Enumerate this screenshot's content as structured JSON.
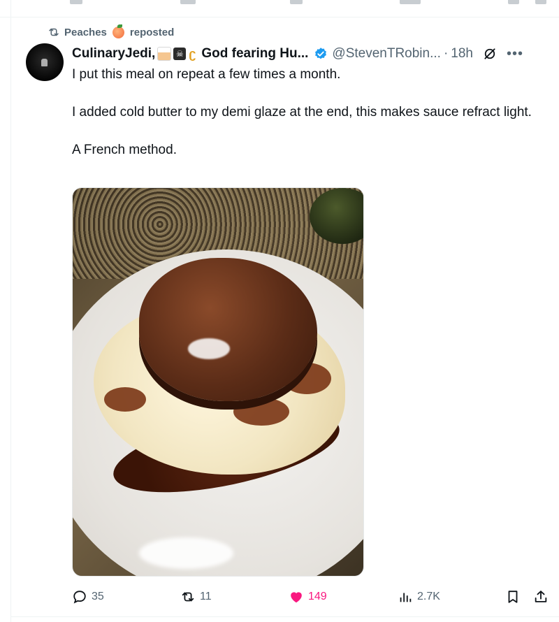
{
  "repost": {
    "user": "Peaches",
    "label": "reposted"
  },
  "author": {
    "display_name": "CulinaryJedi,",
    "name_suffix": "God fearing Hu...",
    "handle": "@StevenTRobin...",
    "separator": "·",
    "time": "18h"
  },
  "tweet": {
    "paragraphs": [
      "I put this meal on repeat a few times a month.",
      "I added cold butter to my demi glaze at the end, this makes sauce refract light.",
      "A French method."
    ]
  },
  "actions": {
    "replies": "35",
    "reposts": "11",
    "likes": "149",
    "views": "2.7K"
  },
  "colors": {
    "like": "#f91880",
    "verified": "#1d9bf0",
    "muted": "#536471"
  },
  "icons": [
    "repost-icon",
    "verified-badge-icon",
    "grok-icon",
    "more-icon",
    "reply-icon",
    "like-icon",
    "views-icon",
    "bookmark-icon",
    "share-icon"
  ]
}
